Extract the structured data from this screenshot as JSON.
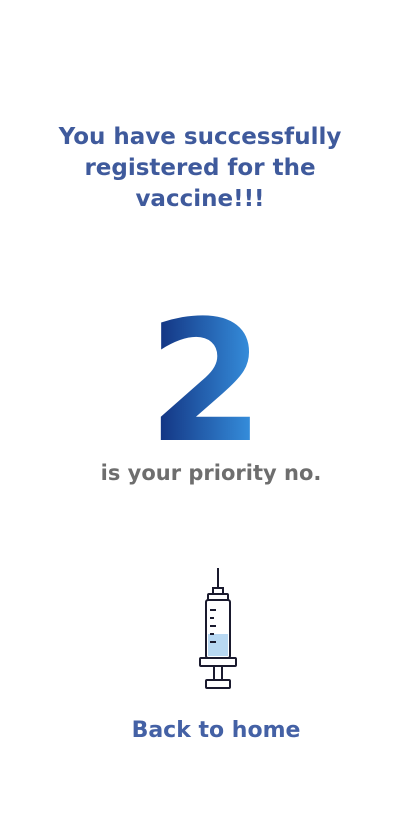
{
  "success": {
    "line1": "You have successfully",
    "line2": "registered for the",
    "line3": "vaccine!!!"
  },
  "priority": {
    "number": "2",
    "label": "is your priority no."
  },
  "illustration": {
    "icon": "syringe-icon"
  },
  "nav": {
    "back_label": "Back to home"
  },
  "colors": {
    "heading": "#3f5a9c",
    "number_gradient_start": "#0f2a78",
    "number_gradient_end": "#3a9ae8",
    "label": "#6e6e6e",
    "link": "#4461a5"
  }
}
